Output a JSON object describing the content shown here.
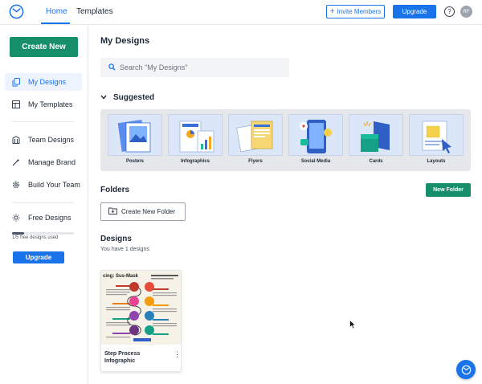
{
  "header": {
    "nav_home": "Home",
    "nav_templates": "Templates",
    "invite_label": "Invite Members",
    "upgrade_label": "Upgrade",
    "help_glyph": "?",
    "avatar_initials": "RF"
  },
  "sidebar": {
    "create_new": "Create New",
    "items": [
      {
        "label": "My Designs",
        "icon": "copy-icon"
      },
      {
        "label": "My Templates",
        "icon": "templates-icon"
      },
      {
        "label": "Team Designs",
        "icon": "building-icon"
      },
      {
        "label": "Manage Brand",
        "icon": "magic-wand-icon"
      },
      {
        "label": "Build Your Team",
        "icon": "gear-icon"
      },
      {
        "label": "Free Designs",
        "icon": "sun-icon"
      }
    ],
    "usage_text": "1/5 free designs used",
    "usage_fraction": 0.2,
    "upgrade_label": "Upgrade"
  },
  "main": {
    "title": "My Designs",
    "search_placeholder": "Search \"My Designs\"",
    "suggested_label": "Suggested",
    "suggested": [
      "Posters",
      "Infographics",
      "Flyers",
      "Social Media",
      "Cards",
      "Layouts"
    ],
    "folders_label": "Folders",
    "new_folder_label": "New Folder",
    "create_folder_label": "Create New Folder",
    "designs_label": "Designs",
    "designs_count": "You have 1 designs",
    "design_card": {
      "name": "Step Process Infographic",
      "thumb_title": "cing: Sus-Mask",
      "menu_glyph": "⋮"
    }
  },
  "colors": {
    "accent": "#1a73e8",
    "brand_green": "#168f6a"
  }
}
